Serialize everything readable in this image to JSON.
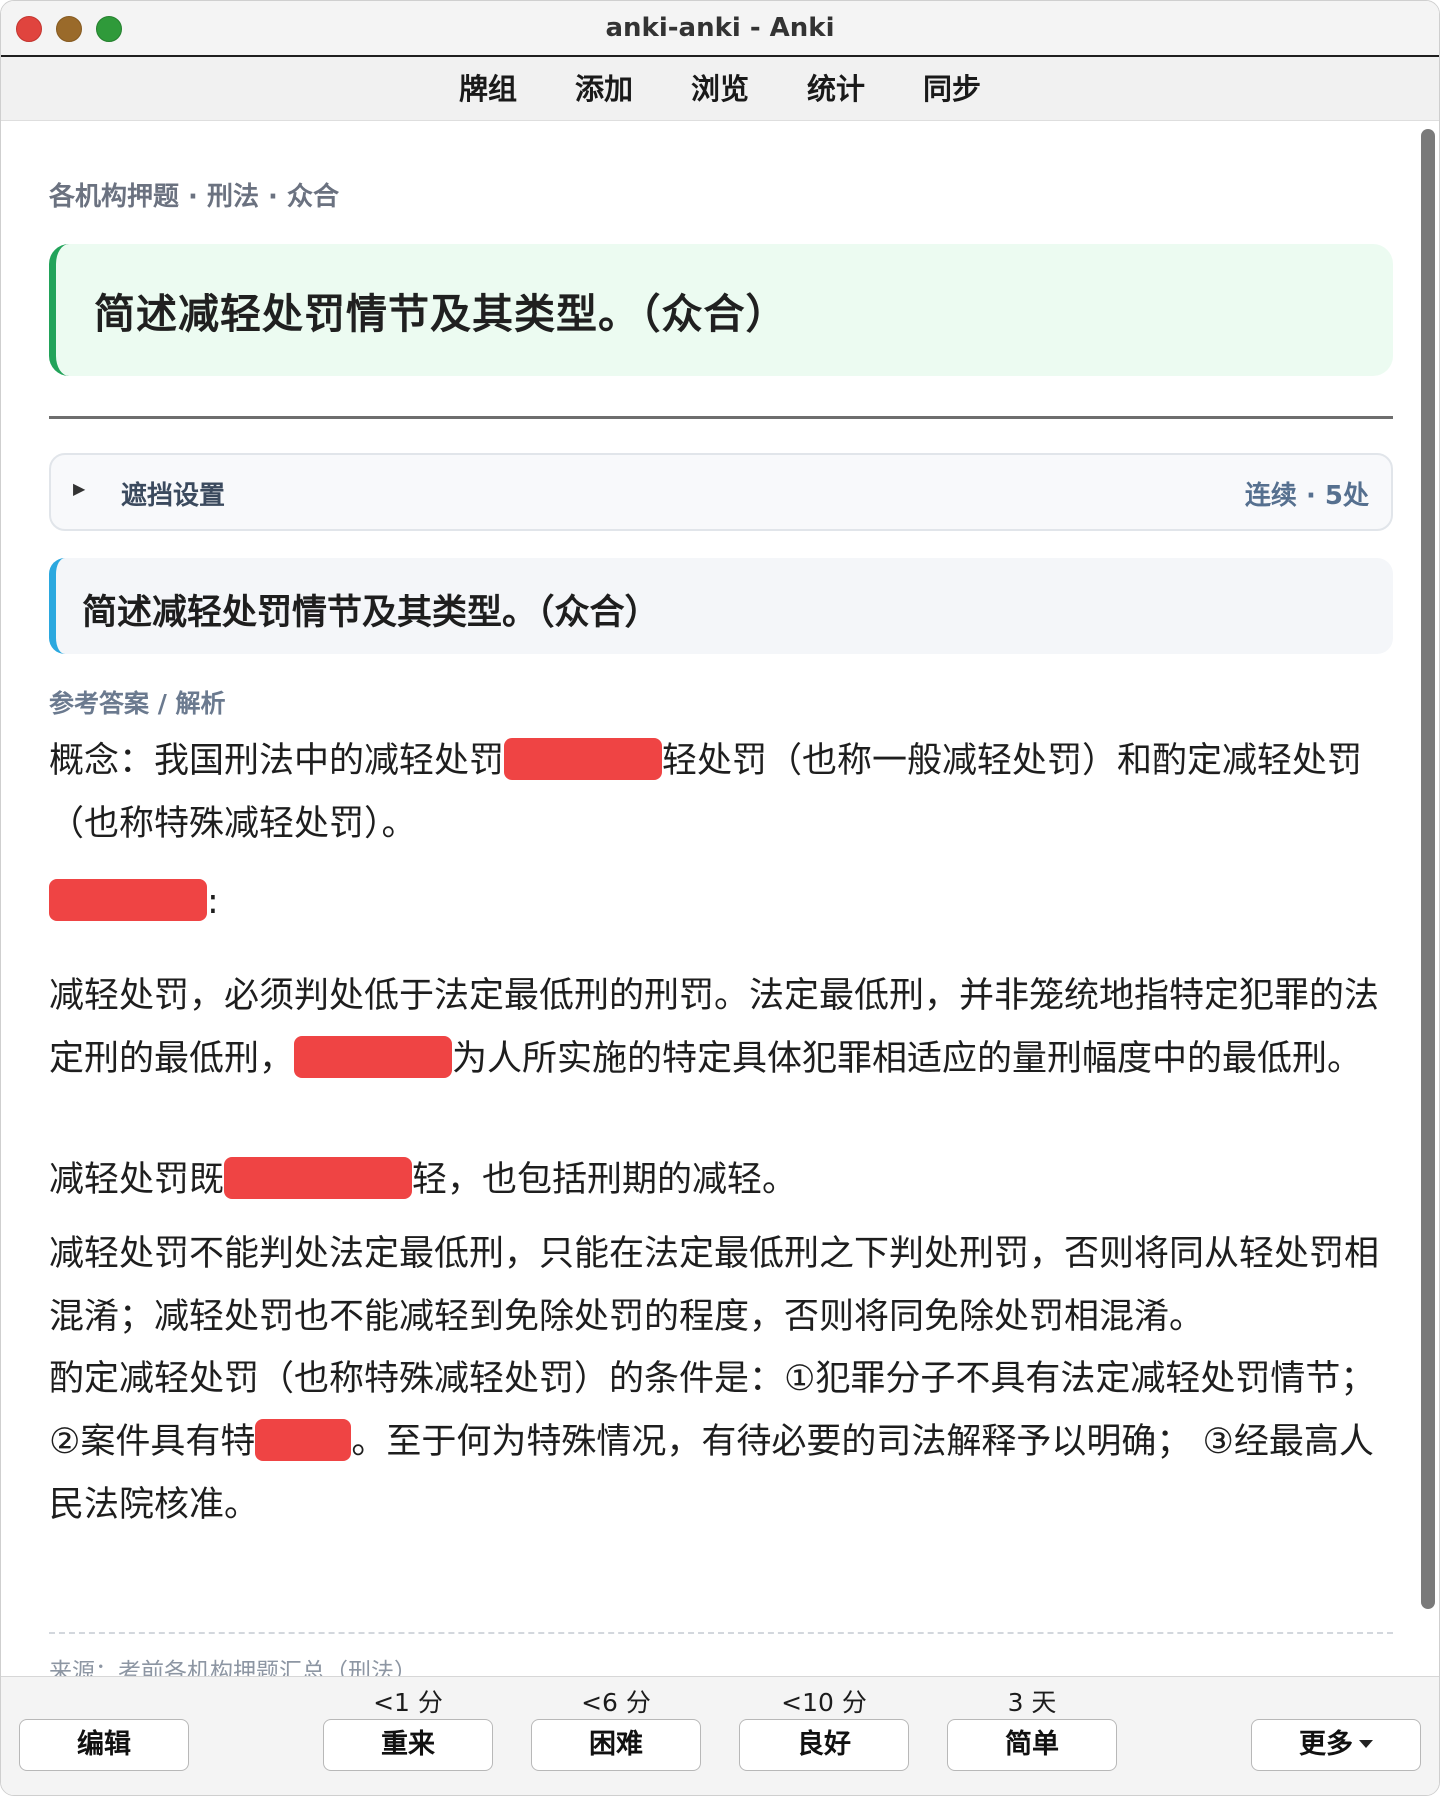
{
  "window": {
    "title": "anki-anki - Anki"
  },
  "toolbar": {
    "items": [
      "牌组",
      "添加",
      "浏览",
      "统计",
      "同步"
    ]
  },
  "card": {
    "breadcrumb": "各机构押题 · 刑法 · 众合",
    "question_header": "简述减轻处罚情节及其类型。（众合）",
    "mask_settings": {
      "label": "遮挡设置",
      "status": "连续 · 5处"
    },
    "question": "简述减轻处罚情节及其类型。（众合）",
    "answer_label": "参考答案 / 解析",
    "paragraphs": {
      "p1a": "概念：我国刑法中的减轻处罚",
      "p1b": "轻处罚（也称一般减轻处罚）和酌定减轻处罚（也称特殊减轻处罚）。",
      "p2": ":",
      "p3a": "减轻处罚，必须判处低于法定最低刑的刑罚。法定最低刑，并非笼统地指特定犯罪的法定刑的最低刑，",
      "p3b": "为人所实施的特定具体犯罪相适应的量刑幅度中的最低刑。",
      "p4a": "减轻处罚既",
      "p4b": "轻，也包括刑期的减轻。",
      "p5": "减轻处罚不能判处法定最低刑，只能在法定最低刑之下判处刑罚，否则将同从轻处罚相混淆；减轻处罚也不能减轻到免除处罚的程度，否则将同免除处罚相混淆。",
      "p6a": "酌定减轻处罚（也称特殊减轻处罚）的条件是：①犯罪分子不具有法定减轻处罚情节；②案件具有特",
      "p6b": "。至于何为特殊情况，有待必要的司法解释予以明确； ③经最高人民法院核准。"
    },
    "source": "来源：考前各机构押题汇总（刑法）",
    "cloze_color": "#ef4444"
  },
  "answer_bar": {
    "edit": "编辑",
    "more": "更多",
    "buttons": [
      {
        "label": "重来",
        "time": "<1 分"
      },
      {
        "label": "困难",
        "time": "<6 分"
      },
      {
        "label": "良好",
        "time": "<10 分"
      },
      {
        "label": "简单",
        "time": "3 天"
      }
    ]
  }
}
